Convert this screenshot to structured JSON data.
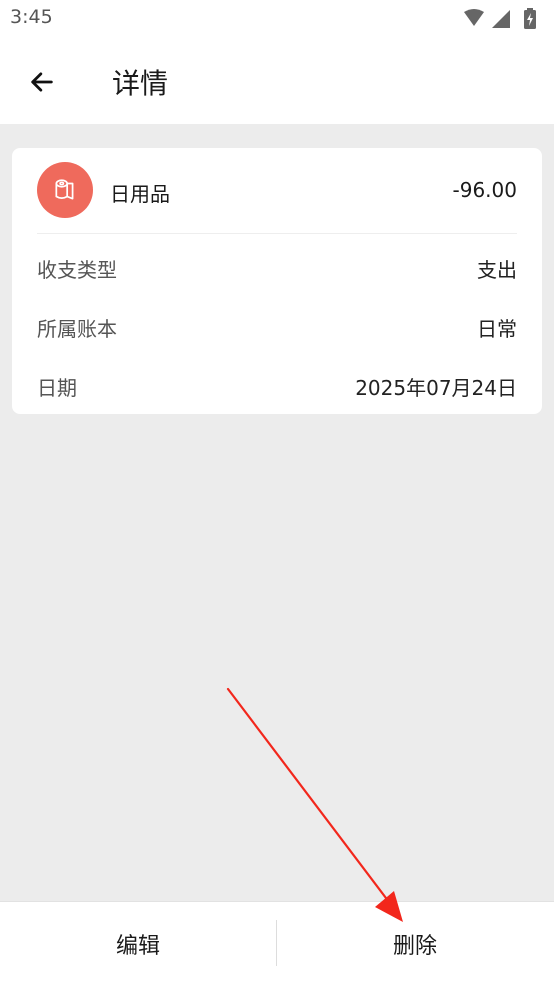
{
  "status_bar": {
    "time": "3:45",
    "icons": [
      "wifi-icon",
      "signal-icon",
      "battery-charging-icon"
    ]
  },
  "app_bar": {
    "title": "详情",
    "back_icon": "arrow-left-icon"
  },
  "detail": {
    "category": {
      "icon": "toilet-paper-icon",
      "icon_color": "#ef6a5c",
      "name": "日用品"
    },
    "amount": "-96.00",
    "rows": [
      {
        "label": "收支类型",
        "value": "支出"
      },
      {
        "label": "所属账本",
        "value": "日常"
      },
      {
        "label": "日期",
        "value": "2025年07月24日"
      }
    ]
  },
  "actions": {
    "edit_label": "编辑",
    "delete_label": "删除"
  },
  "annotation": {
    "arrow_color": "#f2271c",
    "target": "delete-button"
  }
}
